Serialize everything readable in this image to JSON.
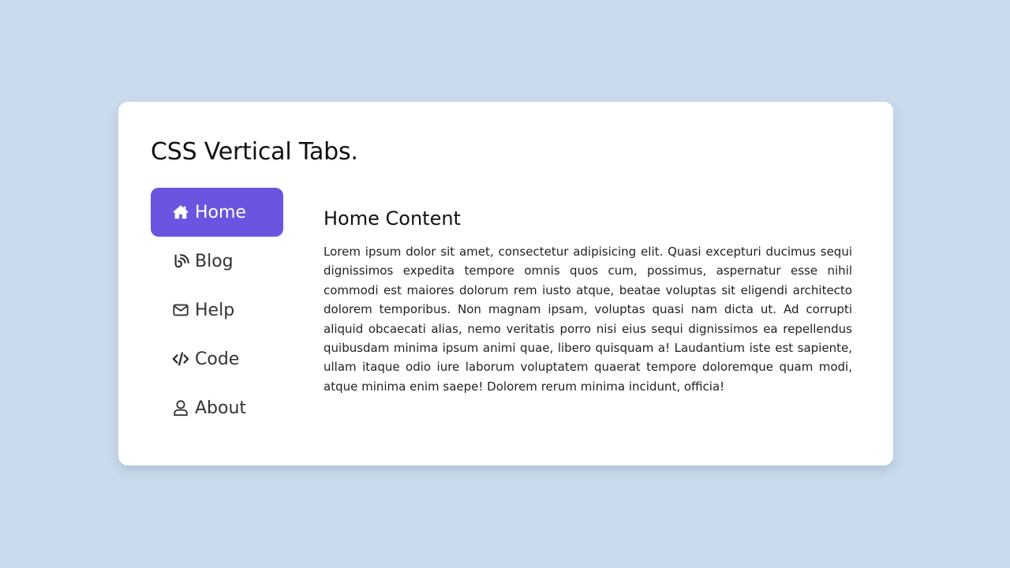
{
  "page": {
    "title": "CSS Vertical Tabs."
  },
  "tabs": [
    {
      "label": "Home",
      "icon": "home-icon",
      "active": true
    },
    {
      "label": "Blog",
      "icon": "blog-icon",
      "active": false
    },
    {
      "label": "Help",
      "icon": "envelope-icon",
      "active": false
    },
    {
      "label": "Code",
      "icon": "code-icon",
      "active": false
    },
    {
      "label": "About",
      "icon": "user-icon",
      "active": false
    }
  ],
  "content": {
    "title": "Home Content",
    "body": "Lorem ipsum dolor sit amet, consectetur adipisicing elit. Quasi excepturi ducimus sequi dignissimos expedita tempore omnis quos cum, possimus, aspernatur esse nihil commodi est maiores dolorum rem iusto atque, beatae voluptas sit eligendi architecto dolorem temporibus. Non magnam ipsam, voluptas quasi nam dicta ut. Ad corrupti aliquid obcaecati alias, nemo veritatis porro nisi eius sequi dignissimos ea repellendus quibusdam minima ipsum animi quae, libero quisquam a! Laudantium iste est sapiente, ullam itaque odio iure laborum voluptatem quaerat tempore doloremque quam modi, atque minima enim saepe! Dolorem rerum minima incidunt, officia!"
  },
  "colors": {
    "background": "#cadbed",
    "card": "#ffffff",
    "accent": "#6b54e0",
    "text": "#333333"
  }
}
